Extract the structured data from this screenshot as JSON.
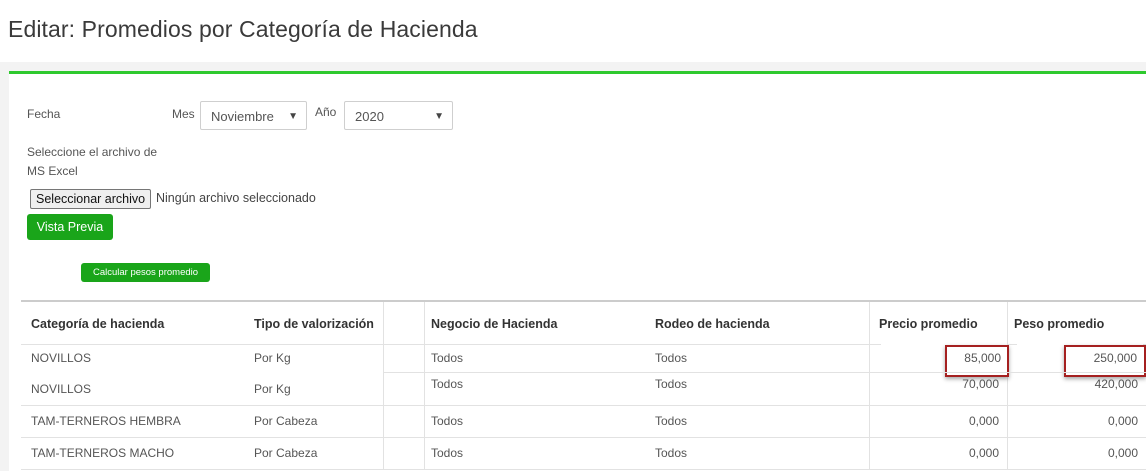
{
  "page": {
    "title": "Editar: Promedios por Categoría de Hacienda"
  },
  "form": {
    "fecha_label": "Fecha",
    "mes_label": "Mes",
    "mes_value": "Noviembre",
    "anio_label": "Año",
    "anio_value": "2020",
    "archivo_label_line1": "Seleccione el archivo de",
    "archivo_label_line2": "MS Excel",
    "file_button": "Seleccionar archivo",
    "file_status": "Ningún archivo seleccionado",
    "preview_button": "Vista Previa",
    "calc_button": "Calcular pesos promedio"
  },
  "table": {
    "headers": [
      "Categoría de hacienda",
      "Tipo de valorización",
      "Negocio de Hacienda",
      "Rodeo de hacienda",
      "Precio promedio",
      "Peso promedio"
    ],
    "rows": [
      [
        "NOVILLOS",
        "Por Kg",
        "Todos",
        "Todos",
        "85,000",
        "250,000"
      ],
      [
        "NOVILLOS",
        "Por Kg",
        "Todos",
        "Todos",
        "70,000",
        "420,000"
      ],
      [
        "TAM-TERNEROS HEMBRA",
        "Por Cabeza",
        "Todos",
        "Todos",
        "0,000",
        "0,000"
      ],
      [
        "TAM-TERNEROS MACHO",
        "Por Cabeza",
        "Todos",
        "Todos",
        "0,000",
        "0,000"
      ]
    ]
  },
  "colors": {
    "accent_green": "#2ec92e",
    "button_green": "#1aa51a",
    "highlight_red": "#a52020"
  },
  "icons": {
    "select_arrow": "chevron-down-icon"
  }
}
